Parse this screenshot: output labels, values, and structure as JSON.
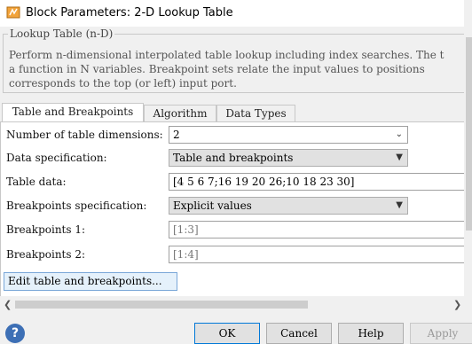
{
  "window": {
    "title": "Block Parameters: 2-D Lookup Table"
  },
  "group": {
    "legend": "Lookup Table (n-D)",
    "description_lines": [
      "Perform n-dimensional interpolated table lookup including index searches. The t",
      "a function in N variables. Breakpoint sets relate the input values to positions",
      "corresponds to the top (or left) input port."
    ]
  },
  "tabs": [
    "Table and Breakpoints",
    "Algorithm",
    "Data Types"
  ],
  "params": {
    "num_dims": {
      "label": "Number of table dimensions:",
      "value": "2"
    },
    "data_spec": {
      "label": "Data specification:",
      "value": "Table and breakpoints"
    },
    "table_data": {
      "label": "Table data:",
      "value": "[4 5 6 7;16 19 20 26;10 18 23 30]"
    },
    "bp_spec": {
      "label": "Breakpoints specification:",
      "value": "Explicit values"
    },
    "bp1": {
      "label": "Breakpoints 1:",
      "value": "[1:3]"
    },
    "bp2": {
      "label": "Breakpoints 2:",
      "value": "[1:4]"
    },
    "edit_button": "Edit table and breakpoints..."
  },
  "buttons": {
    "ok": "OK",
    "cancel": "Cancel",
    "help": "Help",
    "apply": "Apply"
  },
  "icons": {
    "app": "simulink-block-icon",
    "help": "help-question-icon",
    "dropdown": "chevron-down-icon",
    "scroll_left": "scroll-left-arrow-icon",
    "scroll_right": "scroll-right-arrow-icon"
  },
  "colors": {
    "accent": "#0078d7",
    "help_icon": "#3d6fb5"
  }
}
